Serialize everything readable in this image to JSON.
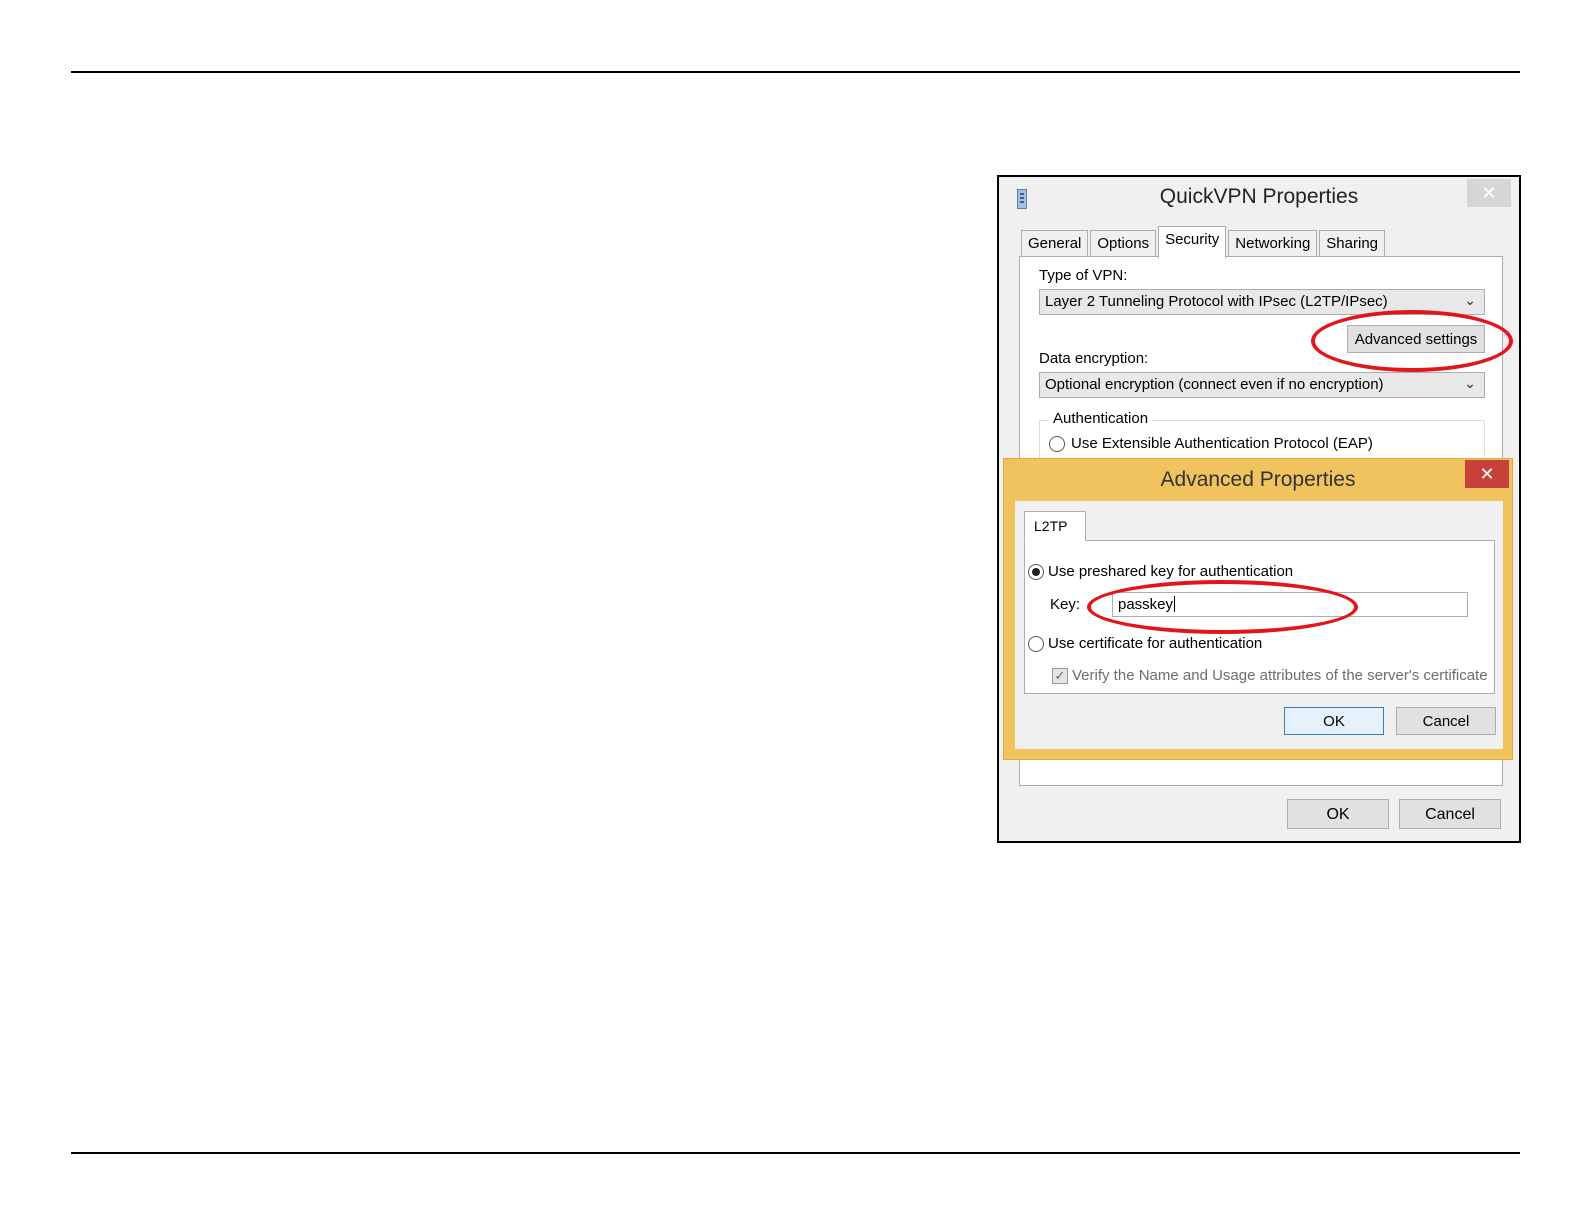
{
  "quickvpn": {
    "title": "QuickVPN Properties",
    "close_glyph": "✕",
    "tabs": [
      "General",
      "Options",
      "Security",
      "Networking",
      "Sharing"
    ],
    "active_tab": "Security",
    "type_of_vpn_label": "Type of VPN:",
    "type_of_vpn_value": "Layer 2 Tunneling Protocol with IPsec (L2TP/IPsec)",
    "advanced_settings_label": "Advanced settings",
    "data_encryption_label": "Data encryption:",
    "data_encryption_value": "Optional encryption (connect even if no encryption)",
    "authentication_group": "Authentication",
    "eap_option": "Use Extensible Authentication Protocol (EAP)",
    "ok_label": "OK",
    "cancel_label": "Cancel"
  },
  "advanced": {
    "title": "Advanced Properties",
    "close_glyph": "✕",
    "tab": "L2TP",
    "preshared_option": "Use preshared key for authentication",
    "preshared_selected": true,
    "key_label": "Key:",
    "key_value": "passkey",
    "certificate_option": "Use certificate for authentication",
    "verify_option": "Verify the Name and Usage attributes of the server's certificate",
    "verify_checked": true,
    "ok_label": "OK",
    "cancel_label": "Cancel"
  },
  "colors": {
    "highlight": "#e3151a",
    "advanced_frame": "#f0c35f",
    "close_red": "#c7403a"
  }
}
